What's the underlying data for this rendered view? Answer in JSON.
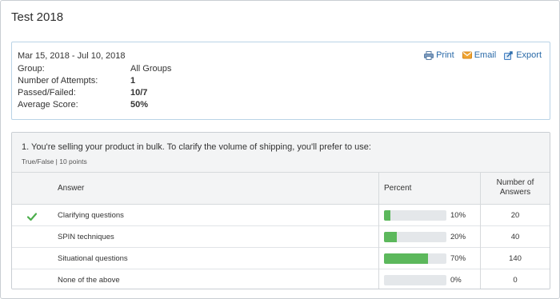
{
  "page": {
    "title": "Test 2018"
  },
  "summary": {
    "date_range": "Mar 15, 2018 - Jul 10, 2018",
    "rows": [
      {
        "label": "Group:",
        "value": "All Groups",
        "bold": false
      },
      {
        "label": "Number of Attempts:",
        "value": "1",
        "bold": true
      },
      {
        "label": "Passed/Failed:",
        "value": "10/7",
        "bold": true
      },
      {
        "label": "Average Score:",
        "value": "50%",
        "bold": true
      }
    ],
    "actions": [
      {
        "label": "Print",
        "icon": "printer-icon"
      },
      {
        "label": "Email",
        "icon": "envelope-icon"
      },
      {
        "label": "Export",
        "icon": "export-icon"
      }
    ]
  },
  "question": {
    "text": "1. You're selling your product in bulk. To clarify the volume of shipping, you'll prefer to use:",
    "meta": "True/False | 10 points",
    "columns": {
      "answer": "Answer",
      "percent": "Percent",
      "count_line1": "Number of",
      "count_line2": "Answers"
    },
    "answers": [
      {
        "label": "Clarifying questions",
        "percent": 10,
        "percent_label": "10%",
        "count": "20",
        "correct": true
      },
      {
        "label": "SPIN techniques",
        "percent": 20,
        "percent_label": "20%",
        "count": "40",
        "correct": false
      },
      {
        "label": "Situational questions",
        "percent": 70,
        "percent_label": "70%",
        "count": "140",
        "correct": false
      },
      {
        "label": "None of the above",
        "percent": 0,
        "percent_label": "0%",
        "count": "0",
        "correct": false
      }
    ]
  },
  "colors": {
    "accent_link": "#2a6aa8",
    "bar_fill": "#5cb85c",
    "bar_track": "#e4e7ea",
    "check": "#4cae4c"
  }
}
